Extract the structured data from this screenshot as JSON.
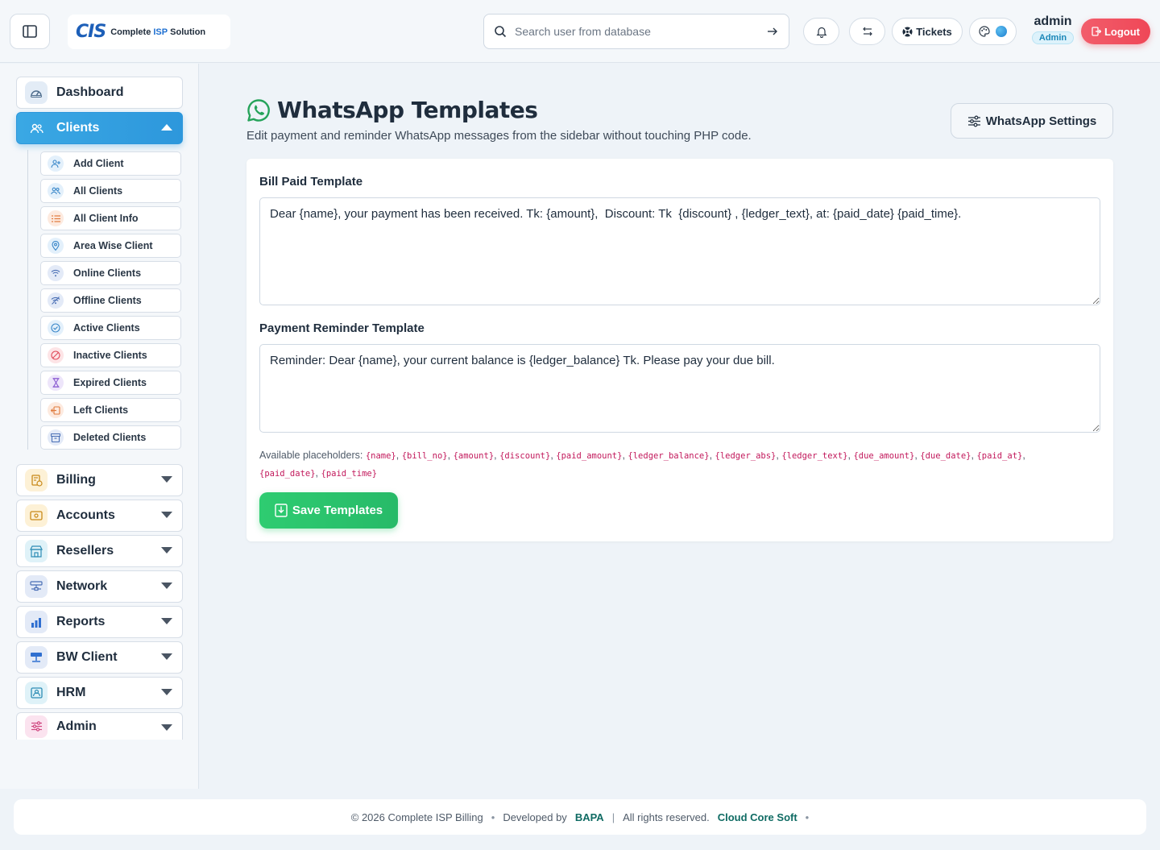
{
  "header": {
    "brand_logo": "CIS",
    "brand_name_pre": "Complete ",
    "brand_name_bold": "ISP",
    "brand_name_post": " Solution",
    "search_placeholder": "Search user from database",
    "tickets_label": "Tickets",
    "user_name": "admin",
    "user_role": "Admin",
    "logout_label": "Logout"
  },
  "sidebar": {
    "dashboard": "Dashboard",
    "clients": "Clients",
    "clients_sub": [
      {
        "label": "Add Client",
        "icon": "user-plus-icon"
      },
      {
        "label": "All Clients",
        "icon": "users-icon"
      },
      {
        "label": "All Client Info",
        "icon": "list-icon"
      },
      {
        "label": "Area Wise Client",
        "icon": "map-pin-icon"
      },
      {
        "label": "Online Clients",
        "icon": "wifi-icon"
      },
      {
        "label": "Offline Clients",
        "icon": "wifi-off-icon"
      },
      {
        "label": "Active Clients",
        "icon": "check-circle-icon"
      },
      {
        "label": "Inactive Clients",
        "icon": "ban-icon"
      },
      {
        "label": "Expired Clients",
        "icon": "hourglass-icon"
      },
      {
        "label": "Left Clients",
        "icon": "door-exit-icon"
      },
      {
        "label": "Deleted Clients",
        "icon": "archive-icon"
      }
    ],
    "billing": "Billing",
    "accounts": "Accounts",
    "resellers": "Resellers",
    "network": "Network",
    "reports": "Reports",
    "bw_client": "BW Client",
    "hrm": "HRM",
    "admin": "Admin"
  },
  "main": {
    "title": "WhatsApp Templates",
    "subtitle": "Edit payment and reminder WhatsApp messages from the sidebar without touching PHP code.",
    "settings_button": "WhatsApp Settings",
    "bill_paid_label": "Bill Paid Template",
    "bill_paid_value": "Dear {name}, your payment has been received. Tk: {amount},  Discount: Tk  {discount} , {ledger_text}, at: {paid_date} {paid_time}.",
    "reminder_label": "Payment Reminder Template",
    "reminder_value": "Reminder: Dear {name}, your current balance is {ledger_balance} Tk. Please pay your due bill.",
    "placeholders_label": "Available placeholders:",
    "placeholders": [
      "{name}",
      "{bill_no}",
      "{amount}",
      "{discount}",
      "{paid_amount}",
      "{ledger_balance}",
      "{ledger_abs}",
      "{ledger_text}",
      "{due_amount}",
      "{due_date}",
      "{paid_at}",
      "{paid_date}",
      "{paid_time}"
    ],
    "save_button": "Save Templates"
  },
  "footer": {
    "copyright": "© 2026 Complete ISP Billing",
    "developed_by": "Developed by",
    "developer": "BAPA",
    "rights": "All rights reserved.",
    "company": "Cloud Core Soft"
  },
  "colors": {
    "accent": "#2d97dc",
    "success": "#2ecc71",
    "danger": "#ef4757",
    "whatsapp": "#25a35a"
  }
}
